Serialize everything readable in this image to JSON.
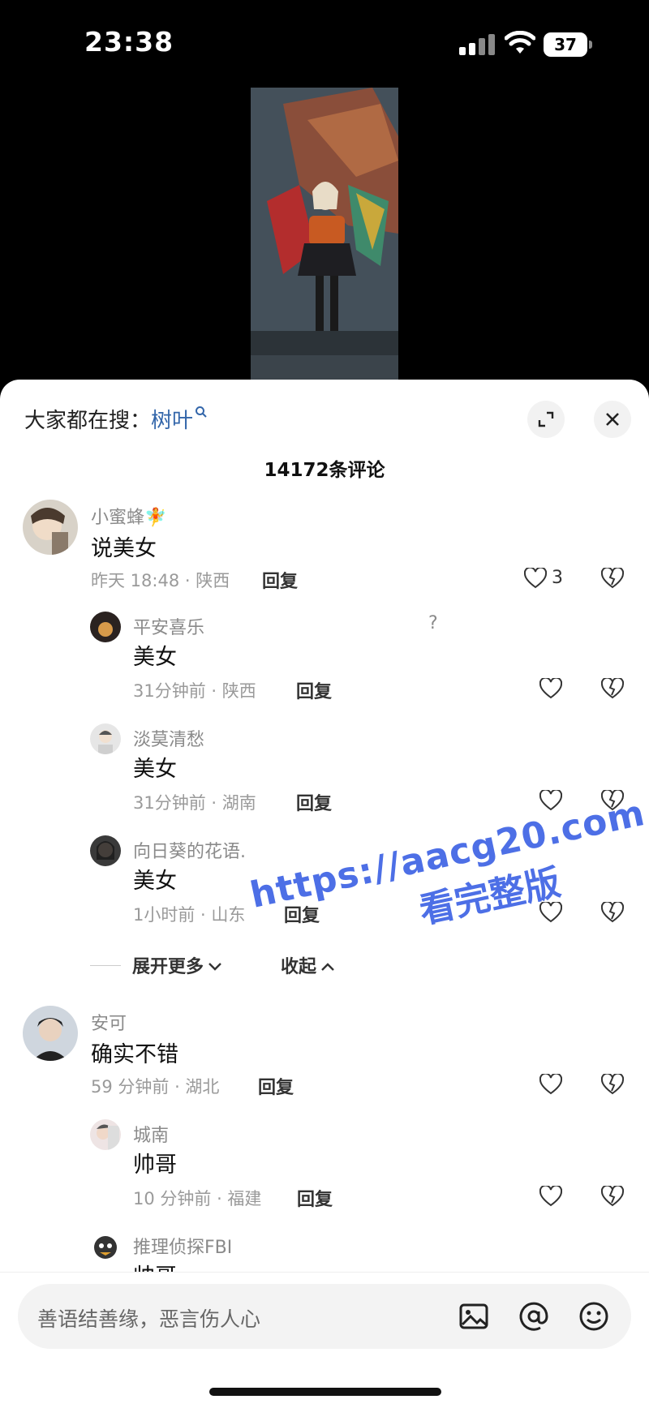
{
  "status_bar": {
    "time": "23:38",
    "battery": "37"
  },
  "sheet": {
    "search_prefix": "大家都在搜：",
    "search_keyword": "树叶",
    "comment_count": "14172条评论"
  },
  "comments": [
    {
      "user": "小蜜蜂🧚",
      "text": "说美女",
      "meta": "昨天 18:48 · 陕西",
      "reply": "回复",
      "likes": "3",
      "replies": [
        {
          "user": "平安喜乐",
          "badge": "?",
          "text": "美女",
          "meta": "31分钟前 · 陕西",
          "reply": "回复"
        },
        {
          "user": "淡莫清愁",
          "text": "美女",
          "meta": "31分钟前 · 湖南",
          "reply": "回复"
        },
        {
          "user": "向日葵的花语.",
          "text": "美女",
          "meta": "1小时前 · 山东",
          "reply": "回复"
        }
      ],
      "expand_more": "展开更多",
      "collapse": "收起"
    },
    {
      "user": "安可",
      "text": "确实不错",
      "meta": "59 分钟前 · 湖北",
      "reply": "回复",
      "replies": [
        {
          "user": "城南",
          "text": "帅哥",
          "meta": "10 分钟前 · 福建",
          "reply": "回复"
        },
        {
          "user": "推理侦探FBI",
          "text": "帅哥"
        }
      ]
    }
  ],
  "watermark": {
    "url": "https://aacg20.com",
    "sub": "看完整版"
  },
  "input": {
    "placeholder": "善语结善缘，恶言伤人心"
  },
  "icons": [
    "signal-icon",
    "wifi-icon",
    "battery-icon",
    "search-icon",
    "expand-icon",
    "close-icon",
    "heart-icon",
    "dislike-heart-icon",
    "chevron-down-icon",
    "chevron-up-icon",
    "image-icon",
    "at-icon",
    "emoji-icon"
  ],
  "colors": {
    "keyword": "#3366aa",
    "watermark": "#4d6fe6",
    "meta": "#9a9a9a"
  }
}
